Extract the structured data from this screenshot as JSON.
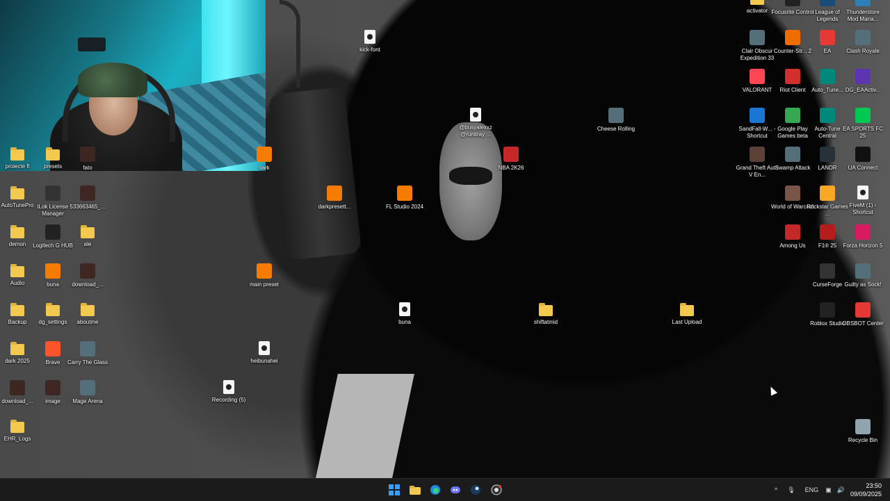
{
  "desktop": {
    "icons": [
      {
        "label": "proiecte fl",
        "type": "folder",
        "icon": "folder-icon"
      },
      {
        "label": "presets",
        "type": "folder",
        "icon": "folder-icon"
      },
      {
        "label": "fato",
        "type": "app",
        "icon": "image-icon"
      },
      {
        "label": "dark",
        "type": "app",
        "icon": "fl-studio-icon"
      },
      {
        "label": "AutoTunePro",
        "type": "folder",
        "icon": "folder-icon"
      },
      {
        "label": "iLok License Manager",
        "type": "app",
        "icon": "ilok-icon"
      },
      {
        "label": "533663465_...",
        "type": "app",
        "icon": "image-icon"
      },
      {
        "label": "demon",
        "type": "folder",
        "icon": "folder-icon"
      },
      {
        "label": "Logitech G HUB",
        "type": "app",
        "icon": "logitech-icon"
      },
      {
        "label": "ale",
        "type": "folder",
        "icon": "folder-icon"
      },
      {
        "label": "Audio",
        "type": "folder",
        "icon": "folder-icon"
      },
      {
        "label": "buna",
        "type": "app",
        "icon": "fl-studio-icon"
      },
      {
        "label": "download_...",
        "type": "app",
        "icon": "image-icon"
      },
      {
        "label": "Backup",
        "type": "folder",
        "icon": "folder-icon"
      },
      {
        "label": "dg_settings",
        "type": "folder",
        "icon": "folder-icon"
      },
      {
        "label": "aboutme",
        "type": "folder",
        "icon": "folder-icon"
      },
      {
        "label": "dark 2025",
        "type": "folder",
        "icon": "folder-icon"
      },
      {
        "label": "Brave",
        "type": "app",
        "icon": "brave-icon"
      },
      {
        "label": "Carry The Glass",
        "type": "app",
        "icon": "game-icon"
      },
      {
        "label": "download_...",
        "type": "app",
        "icon": "image-icon"
      },
      {
        "label": "image",
        "type": "app",
        "icon": "image-icon"
      },
      {
        "label": "Mage Arena",
        "type": "app",
        "icon": "game-icon"
      },
      {
        "label": "EHR_Logs",
        "type": "folder",
        "icon": "folder-icon"
      },
      {
        "label": "kick-font",
        "type": "file",
        "icon": "file-icon"
      },
      {
        "label": "darkpresett...",
        "type": "app",
        "icon": "fl-studio-icon"
      },
      {
        "label": "FL Studio 2024",
        "type": "app",
        "icon": "fl-studio-icon"
      },
      {
        "label": "main preset",
        "type": "app",
        "icon": "fl-studio-icon"
      },
      {
        "label": "heibunahei",
        "type": "file",
        "icon": "media-file-icon"
      },
      {
        "label": "Recording (5)",
        "type": "file",
        "icon": "media-file-icon"
      },
      {
        "label": "buna",
        "type": "file",
        "icon": "media-file-icon"
      },
      {
        "label": "@busyalexxz @runitray ...",
        "type": "file",
        "icon": "media-file-icon"
      },
      {
        "label": "NBA 2K26",
        "type": "app",
        "icon": "nba-icon"
      },
      {
        "label": "Cheese Rolling",
        "type": "app",
        "icon": "game-icon"
      },
      {
        "label": "shiftatmid",
        "type": "folder",
        "icon": "folder-icon"
      },
      {
        "label": "Last Upload",
        "type": "folder",
        "icon": "folder-icon"
      },
      {
        "label": "activator",
        "type": "folder",
        "icon": "folder-icon"
      },
      {
        "label": "Focusrite Control",
        "type": "app",
        "icon": "focusrite-icon"
      },
      {
        "label": "League of Legends",
        "type": "app",
        "icon": "league-icon"
      },
      {
        "label": "Thunderstore Mod Mana...",
        "type": "app",
        "icon": "thunderstore-icon"
      },
      {
        "label": "Clair Obscur Expedition 33",
        "type": "app",
        "icon": "game-icon"
      },
      {
        "label": "Counter-Str... 2",
        "type": "app",
        "icon": "cs2-icon"
      },
      {
        "label": "EA",
        "type": "app",
        "icon": "ea-icon"
      },
      {
        "label": "Clash Royale",
        "type": "app",
        "icon": "game-icon"
      },
      {
        "label": "VALORANT",
        "type": "app",
        "icon": "valorant-icon"
      },
      {
        "label": "Riot Client",
        "type": "app",
        "icon": "riot-icon"
      },
      {
        "label": "Auto_Tune...",
        "type": "app",
        "icon": "autotune-icon"
      },
      {
        "label": "DG_EAActiv...",
        "type": "app",
        "icon": "controller-icon"
      },
      {
        "label": "SandFall-W... - Shortcut",
        "type": "app",
        "icon": "shortcut-icon"
      },
      {
        "label": "Google Play Games beta",
        "type": "app",
        "icon": "google-play-icon"
      },
      {
        "label": "Auto-Tune Central",
        "type": "app",
        "icon": "autotune-icon"
      },
      {
        "label": "EA SPORTS FC 25",
        "type": "app",
        "icon": "ea-fc-icon"
      },
      {
        "label": "Grand Theft Auto V En...",
        "type": "app",
        "icon": "gta-icon"
      },
      {
        "label": "Swamp Attack",
        "type": "app",
        "icon": "game-icon"
      },
      {
        "label": "LANDR",
        "type": "app",
        "icon": "landr-icon"
      },
      {
        "label": "UA Connect",
        "type": "app",
        "icon": "ua-icon"
      },
      {
        "label": "World of Warcraft",
        "type": "app",
        "icon": "wow-icon"
      },
      {
        "label": "Rockstar Games ...",
        "type": "app",
        "icon": "rockstar-icon"
      },
      {
        "label": "FiveM (1) - Shortcut",
        "type": "file",
        "icon": "file-icon"
      },
      {
        "label": "Among Us",
        "type": "app",
        "icon": "among-us-icon"
      },
      {
        "label": "F1® 25",
        "type": "app",
        "icon": "f1-icon"
      },
      {
        "label": "Forza Horizon 5",
        "type": "app",
        "icon": "forza-icon"
      },
      {
        "label": "CurseForge",
        "type": "app",
        "icon": "curseforge-icon"
      },
      {
        "label": "Guilty as Sock!",
        "type": "app",
        "icon": "game-icon"
      },
      {
        "label": "Roblox Studio",
        "type": "app",
        "icon": "roblox-icon"
      },
      {
        "label": "OBSBOT Center",
        "type": "app",
        "icon": "obsbot-icon"
      },
      {
        "label": "Recycle Bin",
        "type": "app",
        "icon": "recycle-bin-icon"
      }
    ]
  },
  "taskbar": {
    "apps": [
      "start-icon",
      "file-explorer-icon",
      "edge-icon",
      "discord-icon",
      "steam-icon",
      "obs-icon"
    ],
    "tray": {
      "language": "ENG",
      "time": "23:50",
      "date": "09/09/2025"
    }
  },
  "colors": {
    "taskbar": "#1b1b1b",
    "folder": "#f3c94f",
    "accent": "#1ab0c4"
  }
}
